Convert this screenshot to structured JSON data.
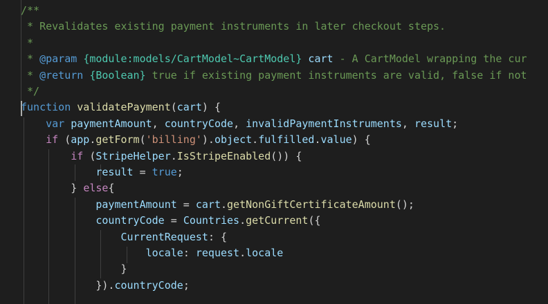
{
  "editor": {
    "lines": [
      [
        {
          "t": "/**",
          "c": "comment"
        }
      ],
      [
        {
          "t": " * Revalidates existing payment instruments in later checkout steps.",
          "c": "comment"
        }
      ],
      [
        {
          "t": " *",
          "c": "comment"
        }
      ],
      [
        {
          "t": " * ",
          "c": "comment"
        },
        {
          "t": "@param",
          "c": "keyword"
        },
        {
          "t": " ",
          "c": "comment"
        },
        {
          "t": "{module:models/CartModel~CartModel}",
          "c": "type"
        },
        {
          "t": " ",
          "c": "comment"
        },
        {
          "t": "cart",
          "c": "var"
        },
        {
          "t": " - A CartModel wrapping the cur",
          "c": "comment"
        }
      ],
      [
        {
          "t": " * ",
          "c": "comment"
        },
        {
          "t": "@return",
          "c": "keyword"
        },
        {
          "t": " ",
          "c": "comment"
        },
        {
          "t": "{Boolean}",
          "c": "type"
        },
        {
          "t": " true if existing payment instruments are valid, false if not",
          "c": "comment"
        }
      ],
      [
        {
          "t": " */",
          "c": "comment"
        }
      ],
      [
        {
          "t": "function",
          "c": "keyword"
        },
        {
          "t": " ",
          "c": "punc"
        },
        {
          "t": "validatePayment",
          "c": "func"
        },
        {
          "t": "(",
          "c": "punc"
        },
        {
          "t": "cart",
          "c": "var"
        },
        {
          "t": ") {",
          "c": "punc"
        }
      ],
      [
        {
          "t": "    ",
          "c": "punc"
        },
        {
          "t": "var",
          "c": "keyword"
        },
        {
          "t": " ",
          "c": "punc"
        },
        {
          "t": "paymentAmount",
          "c": "var"
        },
        {
          "t": ", ",
          "c": "punc"
        },
        {
          "t": "countryCode",
          "c": "var"
        },
        {
          "t": ", ",
          "c": "punc"
        },
        {
          "t": "invalidPaymentInstruments",
          "c": "var"
        },
        {
          "t": ", ",
          "c": "punc"
        },
        {
          "t": "result",
          "c": "var"
        },
        {
          "t": ";",
          "c": "punc"
        }
      ],
      [
        {
          "t": "    ",
          "c": "punc"
        },
        {
          "t": "if",
          "c": "ctrl"
        },
        {
          "t": " (",
          "c": "punc"
        },
        {
          "t": "app",
          "c": "var"
        },
        {
          "t": ".",
          "c": "punc"
        },
        {
          "t": "getForm",
          "c": "func"
        },
        {
          "t": "(",
          "c": "punc"
        },
        {
          "t": "'billing'",
          "c": "string"
        },
        {
          "t": ").",
          "c": "punc"
        },
        {
          "t": "object",
          "c": "var"
        },
        {
          "t": ".",
          "c": "punc"
        },
        {
          "t": "fulfilled",
          "c": "var"
        },
        {
          "t": ".",
          "c": "punc"
        },
        {
          "t": "value",
          "c": "var"
        },
        {
          "t": ") {",
          "c": "punc"
        }
      ],
      [
        {
          "t": "        ",
          "c": "punc"
        },
        {
          "t": "if",
          "c": "ctrl"
        },
        {
          "t": " (",
          "c": "punc"
        },
        {
          "t": "StripeHelper",
          "c": "var"
        },
        {
          "t": ".",
          "c": "punc"
        },
        {
          "t": "IsStripeEnabled",
          "c": "func"
        },
        {
          "t": "()) {",
          "c": "punc"
        }
      ],
      [
        {
          "t": "            ",
          "c": "punc"
        },
        {
          "t": "result",
          "c": "var"
        },
        {
          "t": " = ",
          "c": "punc"
        },
        {
          "t": "true",
          "c": "keyword"
        },
        {
          "t": ";",
          "c": "punc"
        }
      ],
      [
        {
          "t": "        } ",
          "c": "punc"
        },
        {
          "t": "else",
          "c": "ctrl"
        },
        {
          "t": "{",
          "c": "punc"
        }
      ],
      [
        {
          "t": "            ",
          "c": "punc"
        },
        {
          "t": "paymentAmount",
          "c": "var"
        },
        {
          "t": " = ",
          "c": "punc"
        },
        {
          "t": "cart",
          "c": "var"
        },
        {
          "t": ".",
          "c": "punc"
        },
        {
          "t": "getNonGiftCertificateAmount",
          "c": "func"
        },
        {
          "t": "();",
          "c": "punc"
        }
      ],
      [
        {
          "t": "            ",
          "c": "punc"
        },
        {
          "t": "countryCode",
          "c": "var"
        },
        {
          "t": " = ",
          "c": "punc"
        },
        {
          "t": "Countries",
          "c": "var"
        },
        {
          "t": ".",
          "c": "punc"
        },
        {
          "t": "getCurrent",
          "c": "func"
        },
        {
          "t": "({",
          "c": "punc"
        }
      ],
      [
        {
          "t": "                ",
          "c": "punc"
        },
        {
          "t": "CurrentRequest",
          "c": "var"
        },
        {
          "t": ": {",
          "c": "punc"
        }
      ],
      [
        {
          "t": "                    ",
          "c": "punc"
        },
        {
          "t": "locale",
          "c": "var"
        },
        {
          "t": ": ",
          "c": "punc"
        },
        {
          "t": "request",
          "c": "var"
        },
        {
          "t": ".",
          "c": "punc"
        },
        {
          "t": "locale",
          "c": "var"
        }
      ],
      [
        {
          "t": "                }",
          "c": "punc"
        }
      ],
      [
        {
          "t": "            }).",
          "c": "punc"
        },
        {
          "t": "countryCode",
          "c": "var"
        },
        {
          "t": ";",
          "c": "punc"
        }
      ],
      [
        {
          "t": "",
          "c": "punc"
        }
      ]
    ]
  }
}
